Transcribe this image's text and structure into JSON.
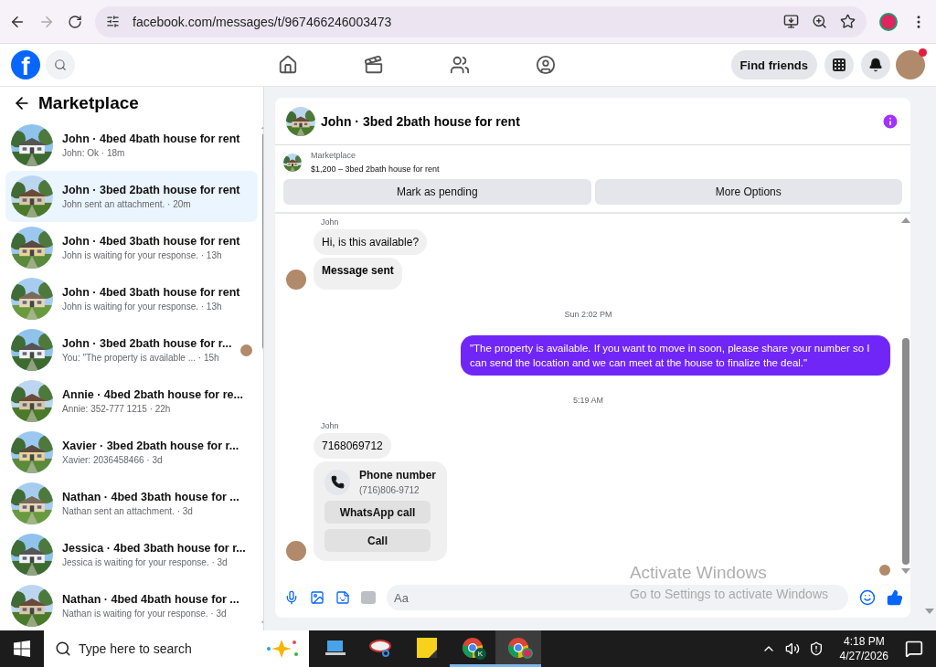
{
  "browser": {
    "url": "facebook.com/messages/t/967466246003473"
  },
  "logo": "f",
  "find_friends": "Find friends",
  "notifications_dot": true,
  "sidebar": {
    "title": "Marketplace",
    "conversations": [
      {
        "title": "John · 4bed 4bath house for rent",
        "preview": "John: Ok · 18m",
        "selected": false,
        "seen": false
      },
      {
        "title": "John · 3bed 2bath house for rent",
        "preview": "John sent an attachment. · 20m",
        "selected": true,
        "seen": false
      },
      {
        "title": "John · 4bed 3bath house for rent",
        "preview": "John is waiting for your response. · 13h",
        "selected": false,
        "seen": false
      },
      {
        "title": "John · 4bed 3bath house for rent",
        "preview": "John is waiting for your response. · 13h",
        "selected": false,
        "seen": false
      },
      {
        "title": "John · 3bed 2bath house for r...",
        "preview": "You: \"The property is available ... · 15h",
        "selected": false,
        "seen": true
      },
      {
        "title": "Annie · 4bed 2bath house for re...",
        "preview": "Annie: 352-777 1215 · 22h",
        "selected": false,
        "seen": false
      },
      {
        "title": "Xavier · 3bed 2bath house for r...",
        "preview": "Xavier: 2036458466 · 3d",
        "selected": false,
        "seen": false
      },
      {
        "title": "Nathan · 4bed 3bath house for ...",
        "preview": "Nathan sent an attachment. · 3d",
        "selected": false,
        "seen": false
      },
      {
        "title": "Jessica · 4bed 3bath house for r...",
        "preview": "Jessica is waiting for your response. · 3d",
        "selected": false,
        "seen": false
      },
      {
        "title": "Nathan · 4bed 4bath house for ...",
        "preview": "Nathan is waiting for your response. · 3d",
        "selected": false,
        "seen": false
      }
    ]
  },
  "chat": {
    "title": "John · 3bed 2bath house for rent",
    "listing": {
      "label": "Marketplace",
      "summary": "$1,200 – 3bed 2bath house for rent",
      "buttons": [
        "Mark as pending",
        "More Options"
      ]
    },
    "messages": [
      {
        "kind": "group",
        "sender": "John",
        "items": [
          {
            "kind": "text",
            "text": "Hi, is this available?"
          },
          {
            "kind": "notice",
            "text": "Message sent"
          }
        ]
      },
      {
        "kind": "timestamp",
        "text": "Sun 2:02 PM"
      },
      {
        "kind": "outgoing",
        "text": "\"The property is available. If you want to move in soon, please share your number so I can send the location and we can meet at the house to finalize the deal.\""
      },
      {
        "kind": "timestamp",
        "text": "5:19 AM"
      },
      {
        "kind": "group",
        "sender": "John",
        "items": [
          {
            "kind": "text",
            "text": "7168069712"
          },
          {
            "kind": "contact",
            "title": "Phone number",
            "detail": "(716)806-9712",
            "actions": [
              "WhatsApp call",
              "Call"
            ]
          }
        ]
      }
    ],
    "seen_by_recipient": true,
    "composer": {
      "placeholder": "Aa"
    }
  },
  "watermark": {
    "title": "Activate Windows",
    "subtitle": "Go to Settings to activate Windows"
  },
  "taskbar": {
    "search_placeholder": "Type here to search",
    "apps": [
      {
        "kind": "computer",
        "running": false,
        "selected": false
      },
      {
        "kind": "snipping",
        "running": false,
        "selected": false
      },
      {
        "kind": "notes",
        "running": false,
        "selected": false
      },
      {
        "kind": "chrome",
        "badge": "K",
        "running": true,
        "selected": false
      },
      {
        "kind": "chrome",
        "running": true,
        "selected": true
      }
    ],
    "time": "4:18 PM",
    "date": "4/27/2026"
  }
}
